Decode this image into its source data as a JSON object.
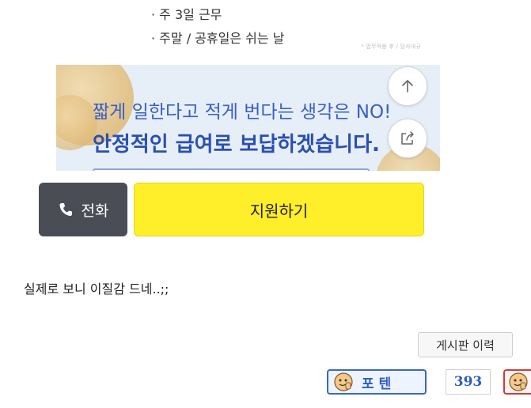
{
  "post_image": {
    "bullets": [
      "· 주 3일 근무",
      "· 주말 / 공휴일은 쉬는 날"
    ],
    "watermark": "* 업무적용 후 / 당사내규",
    "banner_line1": "짧게 일한다고 적게 번다는 생각은 NO!",
    "banner_line2": "안정적인 급여로 보답하겠습니다.",
    "scroll_up_icon": "arrow-up-icon",
    "share_icon": "share-icon"
  },
  "actions": {
    "call_label": "전화",
    "apply_label": "지원하기"
  },
  "comment": {
    "text": "실제로 보니 이질감 드네..;;"
  },
  "board": {
    "history_label": "게시판 이력",
    "poten_label": "포텐",
    "count": "393"
  },
  "colors": {
    "call_bg": "#4a4d56",
    "apply_bg": "#ffef2a",
    "banner_bg": "#e6eef8",
    "banner_text": "#2a4fb0",
    "poten_border": "#3a66c8",
    "red_badge_border": "#d33a3a"
  }
}
